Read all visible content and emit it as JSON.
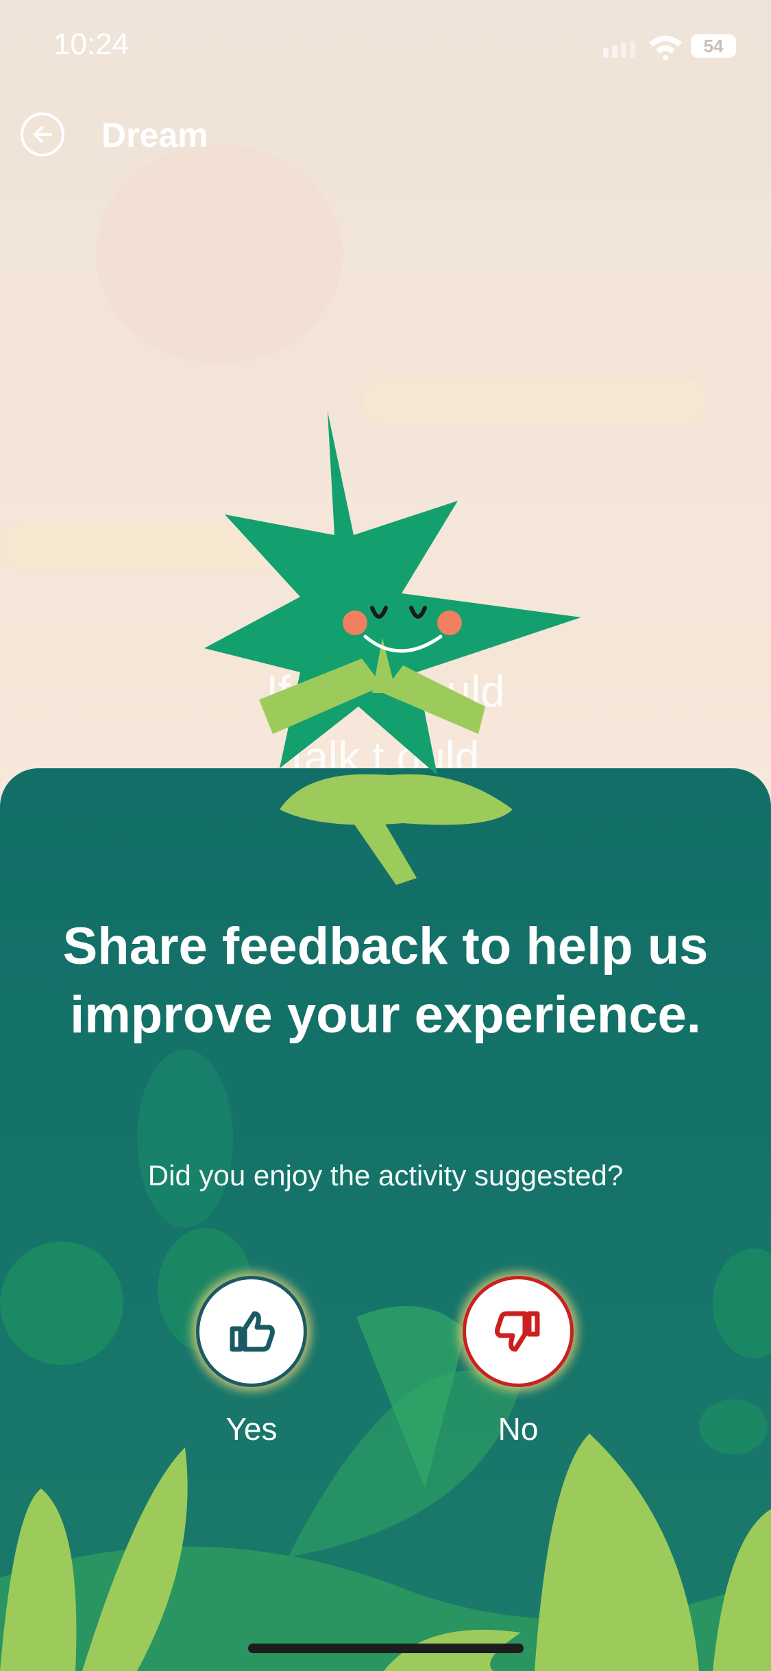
{
  "status_bar": {
    "time": "10:24",
    "battery": "54"
  },
  "header": {
    "title": "Dream"
  },
  "background": {
    "prompt_line1": "If your  could",
    "prompt_line2": "talk t  ould"
  },
  "feedback": {
    "headline": "Share feedback to help us improve your experience.",
    "question": "Did you enjoy the activity suggested?",
    "yes_label": "Yes",
    "no_label": "No"
  },
  "colors": {
    "sheet": "#126e66",
    "yes_ring": "#1b5a64",
    "no_ring": "#cc1f1f",
    "mascot": "#14a06e"
  },
  "icons": [
    "back-arrow-icon",
    "thumbs-up-icon",
    "thumbs-down-icon",
    "wifi-icon",
    "battery-icon",
    "signal-icon"
  ]
}
